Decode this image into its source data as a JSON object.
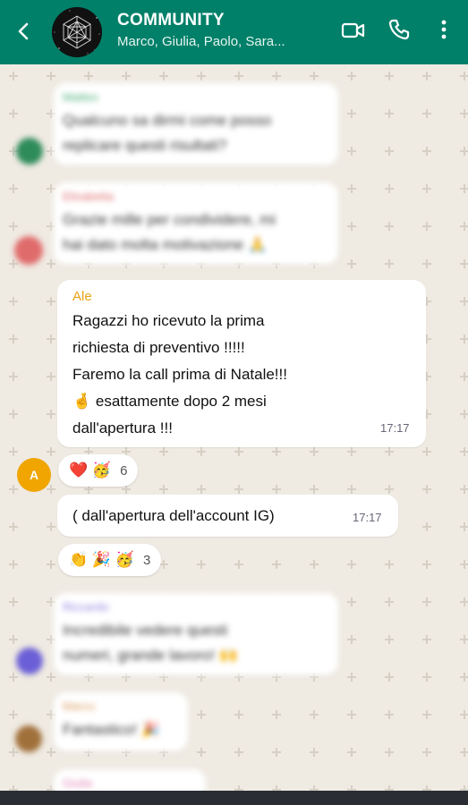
{
  "header": {
    "title": "COMMUNITY",
    "members": "Marco, Giulia, Paolo, Sara...",
    "bg_color": "#008069"
  },
  "messages": [
    {
      "sender": "Matteo",
      "text_lines": [
        "Qualcuno sa dirmi come posso",
        "replicare questi risultati?"
      ],
      "blurred": true,
      "sender_color": "#4caf7a",
      "avatar_color": "#2e8b5a"
    },
    {
      "sender": "Elisabetta",
      "text_lines": [
        "Grazie mille per condividere, mi",
        "hai dato molta motivazione 🙏"
      ],
      "blurred": true,
      "sender_color": "#e06b6b",
      "avatar_color": "#e06b6b"
    },
    {
      "sender": "Ale",
      "text_lines": [
        "Ragazzi ho ricevuto la prima",
        "richiesta di preventivo !!!!!",
        "Faremo la call prima di Natale!!!",
        "🤞 esattamente dopo 2 mesi",
        "dall'apertura !!!"
      ],
      "time": "17:17",
      "sender_color": "#e8a317",
      "avatar_initial": "A"
    },
    {
      "text_lines": [
        "( dall'apertura dell'account IG)"
      ],
      "time": "17:17"
    },
    {
      "sender": "Riccardo",
      "text_lines": [
        "Incredibile vedere questi",
        "numeri, grande lavoro! 🙌"
      ],
      "blurred": true,
      "sender_color": "#8e7fe0",
      "avatar_color": "#6a5fd6"
    },
    {
      "sender": "Marco",
      "text_lines": [
        "Fantastico! 🎉"
      ],
      "blurred": true,
      "sender_color": "#d99a5a",
      "avatar_color": "#a0703a"
    },
    {
      "sender": "Giulia",
      "text_lines": [],
      "blurred": true,
      "sender_color": "#e07fb0"
    }
  ],
  "reactions": [
    {
      "emojis": "❤️ 🥳",
      "count": "6"
    },
    {
      "emojis": "👏 🎉 🥳",
      "count": "3"
    }
  ]
}
